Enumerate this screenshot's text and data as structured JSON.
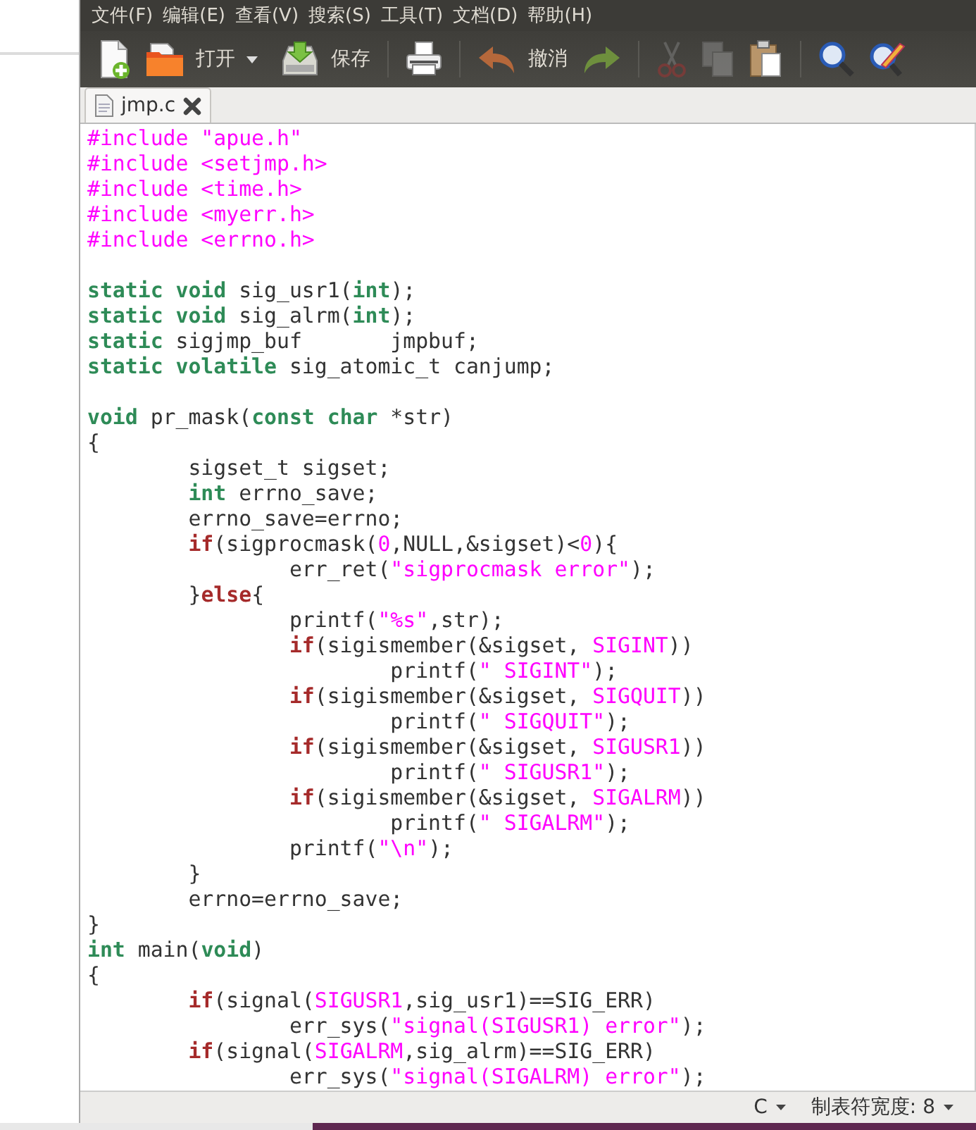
{
  "menu": [
    "文件(F)",
    "编辑(E)",
    "查看(V)",
    "搜索(S)",
    "工具(T)",
    "文档(D)",
    "帮助(H)"
  ],
  "toolbar": [
    {
      "kind": "new"
    },
    {
      "kind": "open",
      "label": "打开"
    },
    {
      "kind": "dropdown"
    },
    {
      "kind": "save",
      "label": "保存"
    },
    {
      "kind": "sep"
    },
    {
      "kind": "print"
    },
    {
      "kind": "sep"
    },
    {
      "kind": "undo",
      "label": "撤消"
    },
    {
      "kind": "redo",
      "disabled": false
    },
    {
      "kind": "sep"
    },
    {
      "kind": "cut",
      "disabled": true
    },
    {
      "kind": "copy",
      "disabled": true
    },
    {
      "kind": "paste"
    },
    {
      "kind": "sep"
    },
    {
      "kind": "find"
    },
    {
      "kind": "replace"
    }
  ],
  "tabs": [
    {
      "label": "jmp.c",
      "selected": true
    }
  ],
  "code_lines": [
    {
      "kind": "code",
      "tokens": [
        {
          "kind": "pre",
          "text": "#include \"apue.h\""
        }
      ]
    },
    {
      "kind": "code",
      "tokens": [
        {
          "kind": "pre",
          "text": "#include <setjmp.h>"
        }
      ]
    },
    {
      "kind": "code",
      "tokens": [
        {
          "kind": "pre",
          "text": "#include <time.h>"
        }
      ]
    },
    {
      "kind": "code",
      "tokens": [
        {
          "kind": "pre",
          "text": "#include <myerr.h>"
        }
      ]
    },
    {
      "kind": "code",
      "tokens": [
        {
          "kind": "pre",
          "text": "#include <errno.h>"
        }
      ]
    },
    {
      "kind": "blank"
    },
    {
      "kind": "code",
      "tokens": [
        {
          "kind": "type",
          "text": "static void"
        },
        {
          "kind": "plain",
          "text": " sig_usr1("
        },
        {
          "kind": "type",
          "text": "int"
        },
        {
          "kind": "plain",
          "text": ");"
        }
      ]
    },
    {
      "kind": "code",
      "tokens": [
        {
          "kind": "type",
          "text": "static void"
        },
        {
          "kind": "plain",
          "text": " sig_alrm("
        },
        {
          "kind": "type",
          "text": "int"
        },
        {
          "kind": "plain",
          "text": ");"
        }
      ]
    },
    {
      "kind": "code",
      "tokens": [
        {
          "kind": "type",
          "text": "static"
        },
        {
          "kind": "plain",
          "text": " sigjmp_buf       jmpbuf;"
        }
      ]
    },
    {
      "kind": "code",
      "tokens": [
        {
          "kind": "type",
          "text": "static volatile"
        },
        {
          "kind": "plain",
          "text": " sig_atomic_t canjump;"
        }
      ]
    },
    {
      "kind": "blank"
    },
    {
      "kind": "code",
      "tokens": [
        {
          "kind": "type",
          "text": "void"
        },
        {
          "kind": "plain",
          "text": " pr_mask("
        },
        {
          "kind": "type",
          "text": "const char"
        },
        {
          "kind": "plain",
          "text": " *str)"
        }
      ]
    },
    {
      "kind": "code",
      "tokens": [
        {
          "kind": "plain",
          "text": "{"
        }
      ]
    },
    {
      "kind": "code",
      "tokens": [
        {
          "kind": "plain",
          "text": "        sigset_t sigset;"
        }
      ]
    },
    {
      "kind": "code",
      "tokens": [
        {
          "kind": "type",
          "text": "        int"
        },
        {
          "kind": "plain",
          "text": " errno_save;"
        }
      ]
    },
    {
      "kind": "code",
      "tokens": [
        {
          "kind": "plain",
          "text": "        errno_save=errno;"
        }
      ]
    },
    {
      "kind": "code",
      "tokens": [
        {
          "kind": "keyword",
          "text": "        if"
        },
        {
          "kind": "plain",
          "text": "(sigprocmask("
        },
        {
          "kind": "number",
          "text": "0"
        },
        {
          "kind": "plain",
          "text": ",NULL,&sigset)<"
        },
        {
          "kind": "number",
          "text": "0"
        },
        {
          "kind": "plain",
          "text": "){"
        }
      ]
    },
    {
      "kind": "code",
      "tokens": [
        {
          "kind": "plain",
          "text": "                err_ret("
        },
        {
          "kind": "string",
          "text": "\"sigprocmask error\""
        },
        {
          "kind": "plain",
          "text": ");"
        }
      ]
    },
    {
      "kind": "code",
      "tokens": [
        {
          "kind": "plain",
          "text": "        }"
        },
        {
          "kind": "keyword",
          "text": "else"
        },
        {
          "kind": "plain",
          "text": "{"
        }
      ]
    },
    {
      "kind": "code",
      "tokens": [
        {
          "kind": "plain",
          "text": "                printf("
        },
        {
          "kind": "string",
          "text": "\"%s\""
        },
        {
          "kind": "plain",
          "text": ",str);"
        }
      ]
    },
    {
      "kind": "code",
      "tokens": [
        {
          "kind": "keyword",
          "text": "                if"
        },
        {
          "kind": "plain",
          "text": "(sigismember(&sigset, "
        },
        {
          "kind": "constant",
          "text": "SIGINT"
        },
        {
          "kind": "plain",
          "text": "))"
        }
      ]
    },
    {
      "kind": "code",
      "tokens": [
        {
          "kind": "plain",
          "text": "                        printf("
        },
        {
          "kind": "string",
          "text": "\" SIGINT\""
        },
        {
          "kind": "plain",
          "text": ");"
        }
      ]
    },
    {
      "kind": "code",
      "tokens": [
        {
          "kind": "keyword",
          "text": "                if"
        },
        {
          "kind": "plain",
          "text": "(sigismember(&sigset, "
        },
        {
          "kind": "constant",
          "text": "SIGQUIT"
        },
        {
          "kind": "plain",
          "text": "))"
        }
      ]
    },
    {
      "kind": "code",
      "tokens": [
        {
          "kind": "plain",
          "text": "                        printf("
        },
        {
          "kind": "string",
          "text": "\" SIGQUIT\""
        },
        {
          "kind": "plain",
          "text": ");"
        }
      ]
    },
    {
      "kind": "code",
      "tokens": [
        {
          "kind": "keyword",
          "text": "                if"
        },
        {
          "kind": "plain",
          "text": "(sigismember(&sigset, "
        },
        {
          "kind": "constant",
          "text": "SIGUSR1"
        },
        {
          "kind": "plain",
          "text": "))"
        }
      ]
    },
    {
      "kind": "code",
      "tokens": [
        {
          "kind": "plain",
          "text": "                        printf("
        },
        {
          "kind": "string",
          "text": "\" SIGUSR1\""
        },
        {
          "kind": "plain",
          "text": ");"
        }
      ]
    },
    {
      "kind": "code",
      "tokens": [
        {
          "kind": "keyword",
          "text": "                if"
        },
        {
          "kind": "plain",
          "text": "(sigismember(&sigset, "
        },
        {
          "kind": "constant",
          "text": "SIGALRM"
        },
        {
          "kind": "plain",
          "text": "))"
        }
      ]
    },
    {
      "kind": "code",
      "tokens": [
        {
          "kind": "plain",
          "text": "                        printf("
        },
        {
          "kind": "string",
          "text": "\" SIGALRM\""
        },
        {
          "kind": "plain",
          "text": ");"
        }
      ]
    },
    {
      "kind": "code",
      "tokens": [
        {
          "kind": "plain",
          "text": "                printf("
        },
        {
          "kind": "string",
          "text": "\"\\n\""
        },
        {
          "kind": "plain",
          "text": ");"
        }
      ]
    },
    {
      "kind": "code",
      "tokens": [
        {
          "kind": "plain",
          "text": "        }"
        }
      ]
    },
    {
      "kind": "code",
      "tokens": [
        {
          "kind": "plain",
          "text": "        errno=errno_save;"
        }
      ]
    },
    {
      "kind": "code",
      "tokens": [
        {
          "kind": "plain",
          "text": "}"
        }
      ]
    },
    {
      "kind": "code",
      "tokens": [
        {
          "kind": "type",
          "text": "int"
        },
        {
          "kind": "plain",
          "text": " main("
        },
        {
          "kind": "type",
          "text": "void"
        },
        {
          "kind": "plain",
          "text": ")"
        }
      ]
    },
    {
      "kind": "code",
      "tokens": [
        {
          "kind": "plain",
          "text": "{"
        }
      ]
    },
    {
      "kind": "code",
      "tokens": [
        {
          "kind": "keyword",
          "text": "        if"
        },
        {
          "kind": "plain",
          "text": "(signal("
        },
        {
          "kind": "constant",
          "text": "SIGUSR1"
        },
        {
          "kind": "plain",
          "text": ",sig_usr1)==SIG_ERR)"
        }
      ]
    },
    {
      "kind": "code",
      "tokens": [
        {
          "kind": "plain",
          "text": "                err_sys("
        },
        {
          "kind": "string",
          "text": "\"signal(SIGUSR1) error\""
        },
        {
          "kind": "plain",
          "text": ");"
        }
      ]
    },
    {
      "kind": "code",
      "tokens": [
        {
          "kind": "keyword",
          "text": "        if"
        },
        {
          "kind": "plain",
          "text": "(signal("
        },
        {
          "kind": "constant",
          "text": "SIGALRM"
        },
        {
          "kind": "plain",
          "text": ",sig_alrm)==SIG_ERR)"
        }
      ]
    },
    {
      "kind": "code",
      "tokens": [
        {
          "kind": "plain",
          "text": "                err_sys("
        },
        {
          "kind": "string",
          "text": "\"signal(SIGALRM) error\""
        },
        {
          "kind": "plain",
          "text": ");"
        }
      ]
    }
  ],
  "status_bar": {
    "language": "C",
    "tab_width": "制表符宽度: 8"
  }
}
